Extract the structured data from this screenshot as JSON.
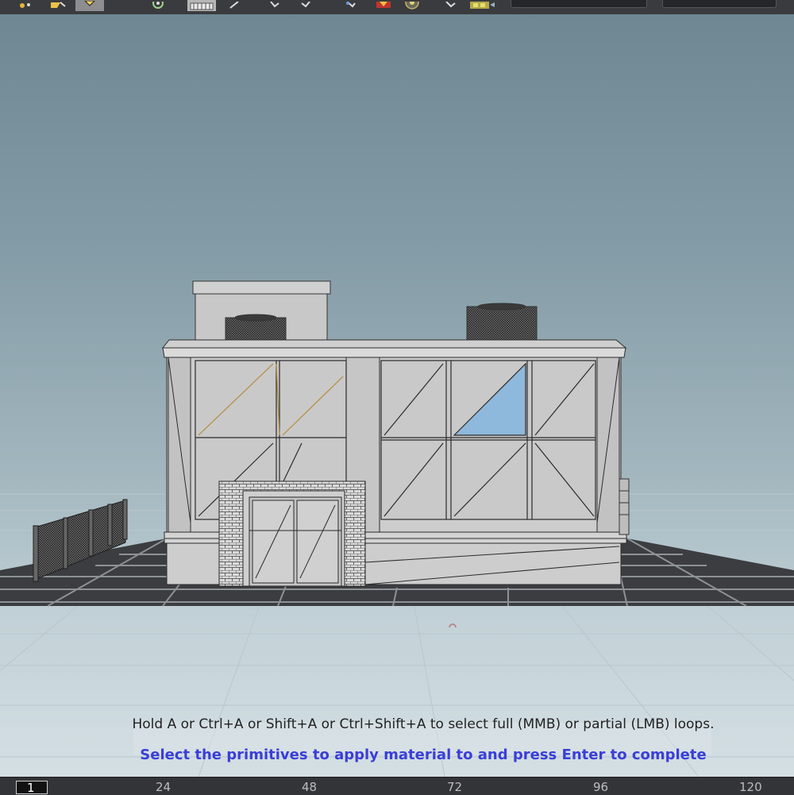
{
  "toolbar": {
    "icons": [
      "select-points-icon",
      "select-edges-icon",
      "select-primitives-icon",
      "snap-icon",
      "grid-icon",
      "tool-icon",
      "move-icon",
      "rotate-icon",
      "pointer-icon",
      "render-icon",
      "camera-icon",
      "arrow-icon",
      "display-icon"
    ]
  },
  "viewport": {
    "hint": "Hold A or Ctrl+A or Shift+A or Ctrl+Shift+A to select full (MMB) or partial (LMB) loops.",
    "status": "Select the primitives to apply material to and press Enter to complete"
  },
  "timeline": {
    "current_frame": "1",
    "ticks": [
      "24",
      "48",
      "72",
      "96",
      "120"
    ]
  }
}
